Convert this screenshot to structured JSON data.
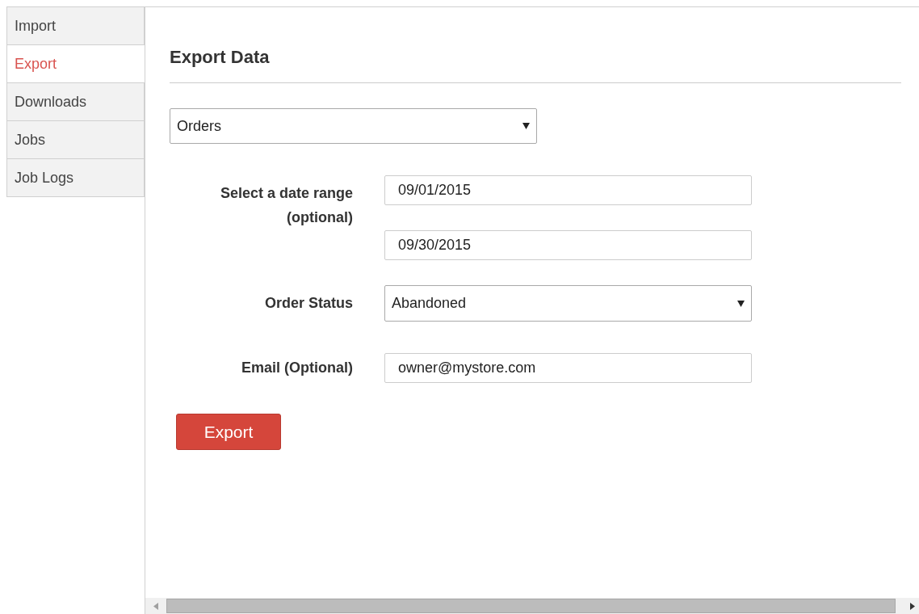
{
  "sidebar": {
    "items": [
      {
        "label": "Import",
        "selected": false
      },
      {
        "label": "Export",
        "selected": true
      },
      {
        "label": "Downloads",
        "selected": false
      },
      {
        "label": "Jobs",
        "selected": false
      },
      {
        "label": "Job Logs",
        "selected": false
      }
    ]
  },
  "heading": "Export Data",
  "export_type": {
    "value": "Orders"
  },
  "form": {
    "date_range": {
      "label": "Select a date range (optional)",
      "start": "09/01/2015",
      "end": "09/30/2015"
    },
    "order_status": {
      "label": "Order Status",
      "value": "Abandoned"
    },
    "email": {
      "label": "Email (Optional)",
      "value": "owner@mystore.com"
    }
  },
  "export_button": "Export"
}
